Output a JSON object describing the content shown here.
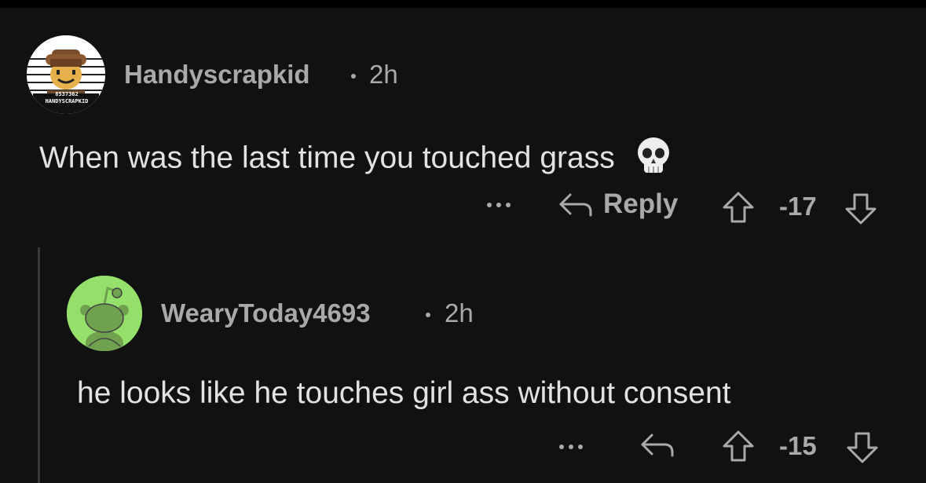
{
  "colors": {
    "background": "#111111",
    "text_primary": "#e2e2e2",
    "text_secondary": "#a9a9a9",
    "thread_line": "#3a3a3a",
    "avatar2_bg": "#94e06a"
  },
  "comments": [
    {
      "author": "Handyscrapkid",
      "time": "2h",
      "body": "When was the last time you touched grass",
      "emoji": "💀",
      "actions": {
        "more_icon": "more-horizontal-icon",
        "reply_icon": "reply-arrow-icon",
        "reply_label": "Reply",
        "upvote_icon": "upvote-arrow-icon",
        "score": "-17",
        "downvote_icon": "downvote-arrow-icon"
      },
      "avatar": {
        "icon": "roblox-avatar",
        "badge_line1": "8537362",
        "badge_line2": "HANDYSCRAPKID"
      }
    },
    {
      "author": "WearyToday4693",
      "time": "2h",
      "body": "he looks like he touches girl ass without consent",
      "actions": {
        "more_icon": "more-horizontal-icon",
        "reply_icon": "reply-arrow-icon",
        "upvote_icon": "upvote-arrow-icon",
        "score": "-15",
        "downvote_icon": "downvote-arrow-icon"
      },
      "avatar": {
        "icon": "reddit-snoo-avatar"
      }
    }
  ]
}
